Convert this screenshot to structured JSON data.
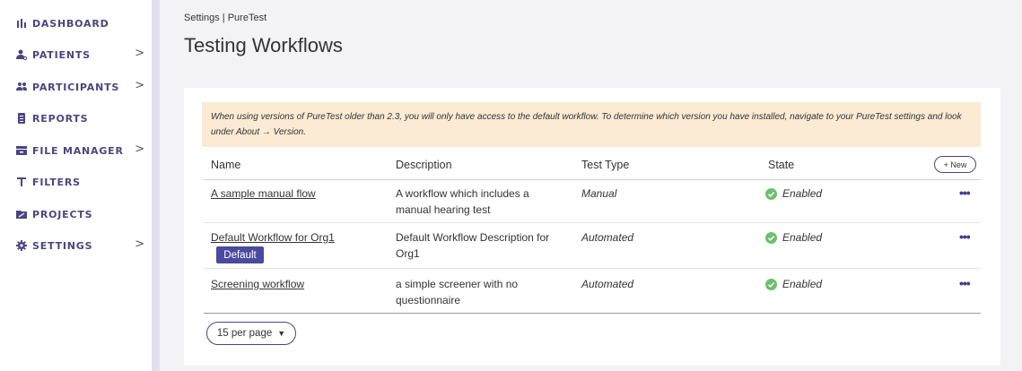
{
  "sidebar": {
    "items": [
      {
        "label": "DASHBOARD",
        "icon": "bar-chart-icon",
        "has_children": false
      },
      {
        "label": "PATIENTS",
        "icon": "patient-icon",
        "has_children": true
      },
      {
        "label": "PARTICIPANTS",
        "icon": "participants-icon",
        "has_children": true
      },
      {
        "label": "REPORTS",
        "icon": "report-icon",
        "has_children": false
      },
      {
        "label": "FILE MANAGER",
        "icon": "file-manager-icon",
        "has_children": true
      },
      {
        "label": "FILTERS",
        "icon": "filter-icon",
        "has_children": false
      },
      {
        "label": "PROJECTS",
        "icon": "projects-icon",
        "has_children": false
      },
      {
        "label": "SETTINGS",
        "icon": "gear-icon",
        "has_children": true
      }
    ],
    "chevron": ">"
  },
  "breadcrumb": "Settings | PureTest",
  "page_title": "Testing Workflows",
  "notice": "When using versions of PureTest older than 2.3, you will only have access to the default workflow. To determine which version you have installed, navigate to your PureTest settings and look under About → Version.",
  "table": {
    "headers": {
      "name": "Name",
      "description": "Description",
      "test_type": "Test Type",
      "state": "State"
    },
    "new_button": "+ New",
    "rows": [
      {
        "name": "A sample manual flow",
        "description": "A workflow which includes a manual hearing test",
        "test_type": "Manual",
        "state": "Enabled",
        "badge": ""
      },
      {
        "name": "Default Workflow for Org1",
        "description": "Default Workflow Description for Org1",
        "test_type": "Automated",
        "state": "Enabled",
        "badge": "Default"
      },
      {
        "name": "Screening workflow",
        "description": "a simple screener with no questionnaire",
        "test_type": "Automated",
        "state": "Enabled",
        "badge": ""
      }
    ],
    "more_label": "•••"
  },
  "pagination": {
    "per_page": "15 per page",
    "caret": "▼"
  },
  "colors": {
    "accent": "#4a4580",
    "badge": "#4b4a9e",
    "enabled": "#6cc070",
    "notice_bg": "#fbead4"
  }
}
